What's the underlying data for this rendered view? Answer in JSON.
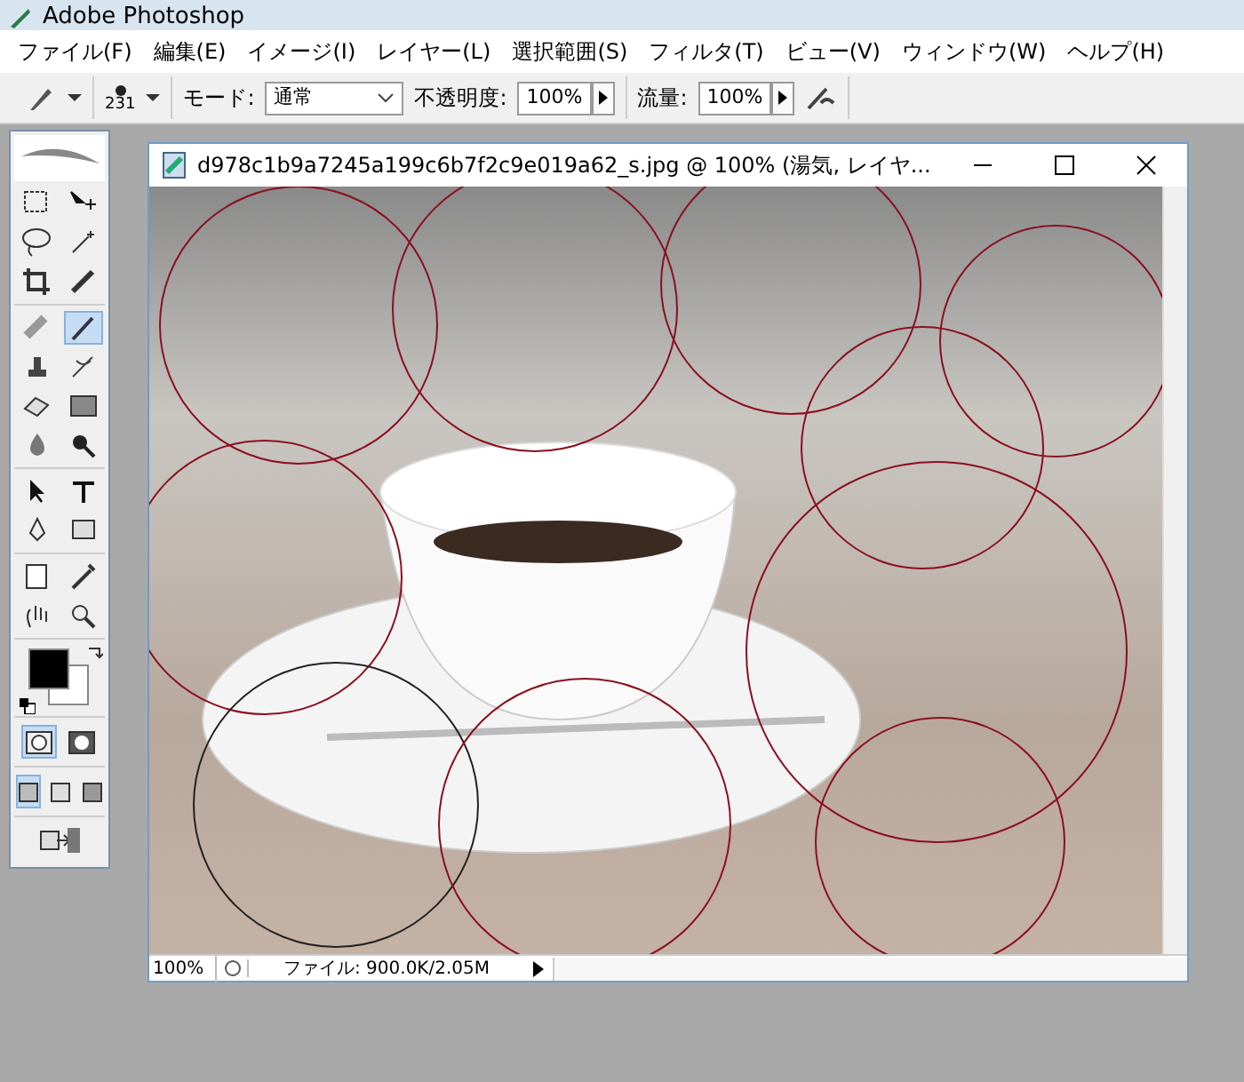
{
  "app_title": "Adobe Photoshop",
  "menu": [
    "ファイル(F)",
    "編集(E)",
    "イメージ(I)",
    "レイヤー(L)",
    "選択範囲(S)",
    "フィルタ(T)",
    "ビュー(V)",
    "ウィンドウ(W)",
    "ヘルプ(H)"
  ],
  "options_bar": {
    "brush_size": "231",
    "mode_label": "モード:",
    "mode_value": "通常",
    "opacity_label": "不透明度:",
    "opacity_value": "100%",
    "flow_label": "流量:",
    "flow_value": "100%"
  },
  "tools": [
    {
      "selected": false
    },
    {
      "selected": false
    },
    {
      "selected": false
    },
    {
      "selected": false
    },
    {
      "selected": false
    },
    {
      "selected": false
    },
    {
      "selected": false
    },
    {
      "selected": true
    },
    {
      "selected": false
    },
    {
      "selected": false
    },
    {
      "selected": false
    },
    {
      "selected": false
    },
    {
      "selected": false
    },
    {
      "selected": false
    },
    {
      "selected": false
    },
    {
      "selected": false
    },
    {
      "selected": false
    },
    {
      "selected": false
    },
    {
      "selected": false
    },
    {
      "selected": false
    },
    {
      "selected": false
    },
    {
      "selected": false
    }
  ],
  "quick_mask": [
    {
      "selected": true
    },
    {
      "selected": false
    }
  ],
  "screen_modes": [
    {
      "selected": true
    },
    {
      "selected": false
    },
    {
      "selected": false
    }
  ],
  "document": {
    "title": "d978c1b9a7245a199c6b7f2c9e019a62_s.jpg @ 100% (湯気, レイヤ...",
    "zoom": "100%",
    "status": "ファイル: 900.0K/2.05M"
  }
}
